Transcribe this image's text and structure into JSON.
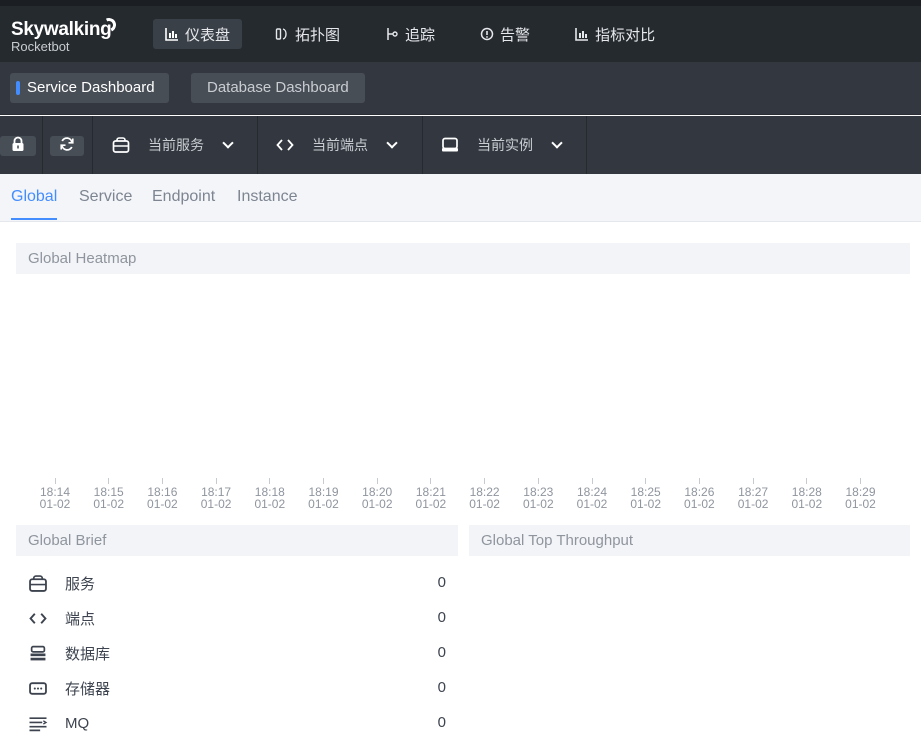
{
  "logo": {
    "main": "Skywalking",
    "sub": "Rocketbot"
  },
  "nav": [
    {
      "label": "仪表盘",
      "icon": "dashboard-chart-icon",
      "active": true
    },
    {
      "label": "拓扑图",
      "icon": "topology-icon",
      "active": false
    },
    {
      "label": "追踪",
      "icon": "trace-icon",
      "active": false
    },
    {
      "label": "告警",
      "icon": "alarm-icon",
      "active": false
    },
    {
      "label": "指标对比",
      "icon": "comparison-chart-icon",
      "active": false
    }
  ],
  "dashboards": {
    "active": "Service Dashboard",
    "inactive": "Database Dashboard"
  },
  "toolbar": {
    "lock_icon": "lock-icon",
    "refresh_icon": "refresh-icon",
    "service": "当前服务",
    "endpoint": "当前端点",
    "instance": "当前实例"
  },
  "subtabs": [
    "Global",
    "Service",
    "Endpoint",
    "Instance"
  ],
  "heatmap": {
    "title": "Global Heatmap",
    "ticks": [
      {
        "time": "18:14",
        "date": "01-02"
      },
      {
        "time": "18:15",
        "date": "01-02"
      },
      {
        "time": "18:16",
        "date": "01-02"
      },
      {
        "time": "18:17",
        "date": "01-02"
      },
      {
        "time": "18:18",
        "date": "01-02"
      },
      {
        "time": "18:19",
        "date": "01-02"
      },
      {
        "time": "18:20",
        "date": "01-02"
      },
      {
        "time": "18:21",
        "date": "01-02"
      },
      {
        "time": "18:22",
        "date": "01-02"
      },
      {
        "time": "18:23",
        "date": "01-02"
      },
      {
        "time": "18:24",
        "date": "01-02"
      },
      {
        "time": "18:25",
        "date": "01-02"
      },
      {
        "time": "18:26",
        "date": "01-02"
      },
      {
        "time": "18:27",
        "date": "01-02"
      },
      {
        "time": "18:28",
        "date": "01-02"
      },
      {
        "time": "18:29",
        "date": "01-02"
      }
    ]
  },
  "brief": {
    "title": "Global Brief",
    "rows": [
      {
        "label": "服务",
        "value": "0",
        "icon": "service-icon"
      },
      {
        "label": "端点",
        "value": "0",
        "icon": "endpoint-icon"
      },
      {
        "label": "数据库",
        "value": "0",
        "icon": "database-icon"
      },
      {
        "label": "存储器",
        "value": "0",
        "icon": "storage-icon"
      },
      {
        "label": "MQ",
        "value": "0",
        "icon": "mq-icon"
      }
    ]
  },
  "throughput": {
    "title": "Global Top Throughput"
  }
}
